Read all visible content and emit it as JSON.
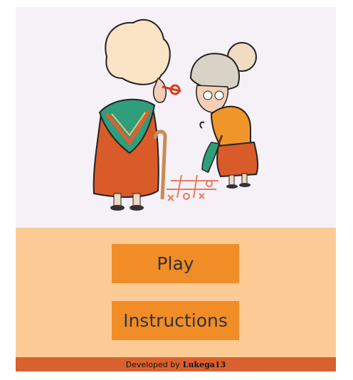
{
  "colors": {
    "background": "#f6f0f7",
    "menu_panel": "#fccb95",
    "button": "#f18d27",
    "button_text": "#333333",
    "footer": "#d9602f"
  },
  "illustration": {
    "subject": "two grannies playing tic-tac-toe on the pavement"
  },
  "menu": {
    "play_label": "Play",
    "instructions_label": "Instructions"
  },
  "footer": {
    "prefix": "Developed by",
    "author": "Lukega13"
  }
}
